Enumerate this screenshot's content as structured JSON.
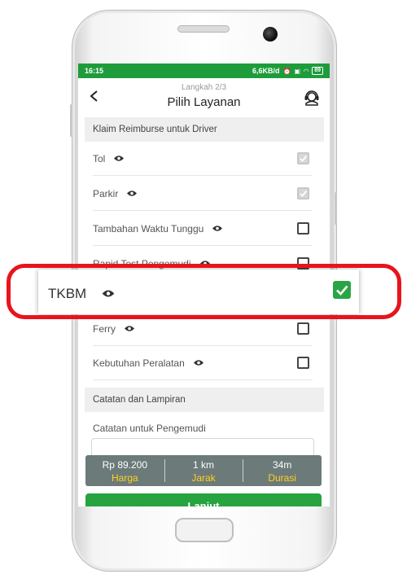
{
  "status_bar": {
    "time": "16:15",
    "net_speed": "6,6KB/d",
    "battery": "89"
  },
  "header": {
    "step": "Langkah 2/3",
    "title": "Pilih Layanan"
  },
  "reimburse_section": {
    "title": "Klaim Reimburse untuk Driver",
    "items": [
      {
        "label": "Tol",
        "checked": true,
        "disabled": true
      },
      {
        "label": "Parkir",
        "checked": true,
        "disabled": true
      },
      {
        "label": "Tambahan Waktu Tunggu",
        "checked": false,
        "disabled": false
      },
      {
        "label": "Rapid Test Pengemudi",
        "checked": false,
        "disabled": false
      },
      {
        "label": "TKBM",
        "checked": true,
        "disabled": false
      },
      {
        "label": "Ferry",
        "checked": false,
        "disabled": false
      },
      {
        "label": "Kebutuhan Peralatan",
        "checked": false,
        "disabled": false
      }
    ]
  },
  "notes_section": {
    "title": "Catatan dan Lampiran",
    "driver_notes_label": "Catatan untuk Pengemudi",
    "driver_notes_value": ""
  },
  "summary": {
    "price": "Rp 89.200",
    "price_label": "Harga",
    "distance": "1 km",
    "distance_label": "Jarak",
    "duration": "34m",
    "duration_label": "Durasi"
  },
  "next_button_label": "Lanjut",
  "colors": {
    "brand_green": "#1e9c3c",
    "highlight_red": "#e8141c",
    "summary_gray": "#6c7a7a",
    "summary_accent": "#ffd21a"
  }
}
